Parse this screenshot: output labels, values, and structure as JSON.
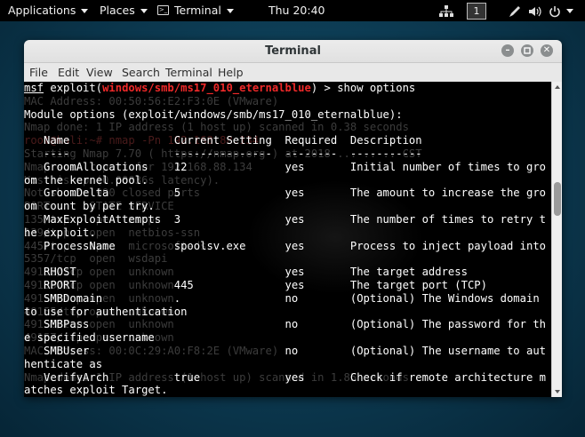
{
  "topbar": {
    "applications": "Applications",
    "places": "Places",
    "terminal": "Terminal",
    "clock": "Thu 20:40",
    "workspace": "1",
    "icons": [
      "network-icon",
      "pen-icon",
      "volume-icon",
      "power-icon"
    ]
  },
  "window": {
    "title": "Terminal",
    "menu": [
      "File",
      "Edit",
      "View",
      "Search",
      "Terminal",
      "Help"
    ]
  },
  "terminal": {
    "prompt": {
      "msf": "msf",
      "pre": " exploit(",
      "module": "windows/smb/ms17_010_eternalblue",
      "post": ") > show options"
    },
    "lines": [
      "",
      "Module options (exploit/windows/smb/ms17_010_eternalblue):",
      "",
      "   Name                Current Setting  Required  Description",
      "   ----                ---------------  --------  -----------",
      "   GroomAllocations    12               yes       Initial number of times to gro",
      "om the kernel pool.",
      "   GroomDelta          5                yes       The amount to increase the gro",
      "om count by per try.",
      "   MaxExploitAttempts  3                yes       The number of times to retry t",
      "he exploit.",
      "   ProcessName         spoolsv.exe      yes       Process to inject payload into",
      "",
      "   RHOST                                yes       The target address",
      "   RPORT               445              yes       The target port (TCP)",
      "   SMBDomain           .                no        (Optional) The Windows domain ",
      "to use for authentication",
      "   SMBPass                              no        (Optional) The password for th",
      "e specified username",
      "   SMBUser                              no        (Optional) The username to aut",
      "henticate as",
      "   VerifyArch          true             yes       Check if remote architecture m",
      "atches exploit Target."
    ],
    "ghost_lines": [
      {
        "row": 1,
        "text": "MAC Address: 00:50:56:E2:F3:0E (VMware)"
      },
      {
        "row": 3,
        "text": "Nmap done: 1 IP address (1 host up) scanned in 0.38 seconds"
      },
      {
        "row": 4,
        "text": "root@kali:~# nmap -Pn 192.168.88.134",
        "red": true
      },
      {
        "row": 5,
        "text": "Starting Nmap 7.70 ( https://nmap.org ) at 2018-...-.. .. CST"
      },
      {
        "row": 6,
        "text": "Nmap scan report for 192.168.88.134"
      },
      {
        "row": 7,
        "text": "Host is up (0.00036s latency)."
      },
      {
        "row": 8,
        "text": "Not shown: 990 closed ports"
      },
      {
        "row": 9,
        "text": "PORT      STATE SERVICE"
      },
      {
        "row": 10,
        "text": "135/tcp   open  msrpc"
      },
      {
        "row": 11,
        "text": "139/tcp   open  netbios-ssn"
      },
      {
        "row": 12,
        "text": "445/tcp   open  microsoft-ds"
      },
      {
        "row": 13,
        "text": "5357/tcp  open  wsdapi"
      },
      {
        "row": 14,
        "text": "49152/tcp open  unknown"
      },
      {
        "row": 15,
        "text": "49153/tcp open  unknown"
      },
      {
        "row": 16,
        "text": "49154/tcp open  unknown"
      },
      {
        "row": 17,
        "text": "49155/tcp open  unknown"
      },
      {
        "row": 18,
        "text": "49156/tcp open  unknown"
      },
      {
        "row": 19,
        "text": "49157/tcp open  unknown"
      },
      {
        "row": 20,
        "text": "MAC Address: 00:0C:29:A0:F8:2E (VMware)"
      },
      {
        "row": 22,
        "text": "Nmap done: 1 IP address (1 host up) scanned in 1.85 seconds"
      }
    ]
  }
}
